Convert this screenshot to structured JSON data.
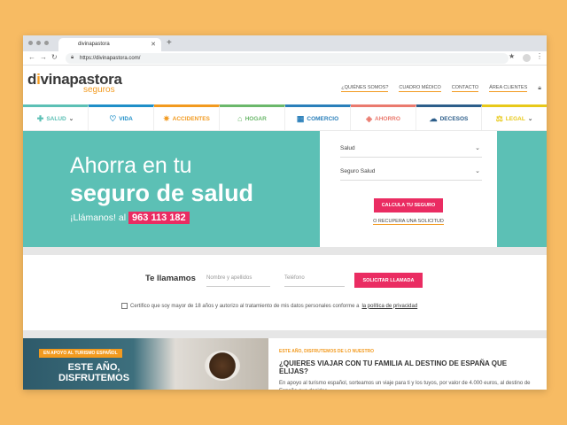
{
  "browser": {
    "tab_title": "divinapastora",
    "url": "https://divinapastora.com/"
  },
  "brand": {
    "main_pre": "d",
    "main_i": "i",
    "main_post": "vinapastora",
    "sub": "seguros"
  },
  "toplinks": [
    "¿QUIÉNES SOMOS?",
    "CUADRO MÉDICO",
    "CONTACTO",
    "ÁREA CLIENTES"
  ],
  "categories": [
    {
      "label": "SALUD",
      "icon": "cross-icon",
      "glyph": "✚",
      "color": "#5cc0b5",
      "chevron": "⌄"
    },
    {
      "label": "VIDA",
      "icon": "heart-icon",
      "glyph": "♡",
      "color": "#1f8fc8",
      "chevron": ""
    },
    {
      "label": "ACCIDENTES",
      "icon": "sun-icon",
      "glyph": "✷",
      "color": "#f29a1f",
      "chevron": ""
    },
    {
      "label": "HOGAR",
      "icon": "house-icon",
      "glyph": "⌂",
      "color": "#6bb86b",
      "chevron": ""
    },
    {
      "label": "COMERCIO",
      "icon": "shop-icon",
      "glyph": "▦",
      "color": "#2a7fba",
      "chevron": ""
    },
    {
      "label": "AHORRO",
      "icon": "tag-icon",
      "glyph": "◈",
      "color": "#ea7a6e",
      "chevron": ""
    },
    {
      "label": "DECESOS",
      "icon": "cloud-icon",
      "glyph": "☁",
      "color": "#2d5e8a",
      "chevron": ""
    },
    {
      "label": "LEGAL",
      "icon": "scales-icon",
      "glyph": "⚖",
      "color": "#e8c91a",
      "chevron": "⌄"
    }
  ],
  "hero": {
    "line1": "Ahorra en tu",
    "line2": "seguro de salud",
    "call_text": "¡Llámanos! al",
    "phone": "963 113 182"
  },
  "quote_form": {
    "select1": "Salud",
    "select2": "Seguro Salud",
    "button": "CALCULA TU SEGURO",
    "recover": "O RECUPERA UNA SOLICITUD"
  },
  "callback": {
    "title": "Te llamamos",
    "name_placeholder": "Nombre y apellidos",
    "phone_placeholder": "Teléfono",
    "button": "SOLICITAR LLAMADA",
    "consent": "Certifico que soy mayor de 18 años y autorizo al tratamiento de mis datos personales conforme a",
    "privacy_link": "la política de privacidad"
  },
  "promo": {
    "badge": "EN APOYO AL TURISMO ESPAÑOL",
    "headline": "ESTE AÑO,\nDISFRUTEMOS",
    "kicker": "ESTE AÑO, DISFRUTEMOS DE LO NUESTRO",
    "title": "¿QUIERES VIAJAR CON TU FAMILIA AL DESTINO DE ESPAÑA QUE ELIJAS?",
    "body": "En apoyo al turismo español, sorteamos un viaje para ti y los tuyos, por valor de 4.000 euros, al destino de España que decidas."
  }
}
